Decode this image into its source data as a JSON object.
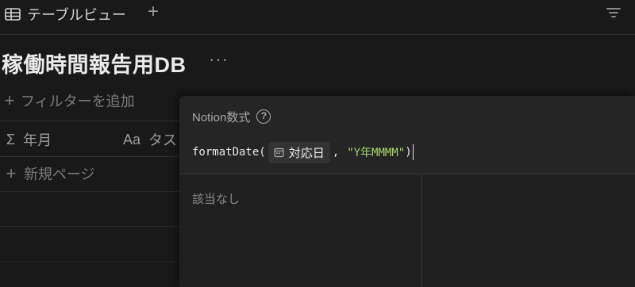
{
  "tabbar": {
    "view_label": "テーブルビュー",
    "view_icon": "table-icon",
    "add_view_glyph": "+",
    "filter_icon": "sort-filter-icon"
  },
  "database": {
    "title": "稼働時間報告用DB",
    "more_glyph": "···"
  },
  "filter": {
    "add_label": "フィルターを追加",
    "plus_glyph": "+"
  },
  "table": {
    "columns": [
      {
        "icon": "Σ",
        "label": "年月"
      },
      {
        "icon": "Aa",
        "label": "タス"
      }
    ],
    "new_page_label": "新規ページ"
  },
  "formula_editor": {
    "title": "Notion数式",
    "help_glyph": "?",
    "fn_name": "formatDate",
    "open_paren": "(",
    "property_name": "対応日",
    "comma": ",",
    "format_string": "\"Y年MMMM\"",
    "close_paren": ")",
    "no_results": "該当なし"
  },
  "colors": {
    "background": "#191919",
    "popup": "#252525",
    "string_literal": "#a7d36b"
  }
}
